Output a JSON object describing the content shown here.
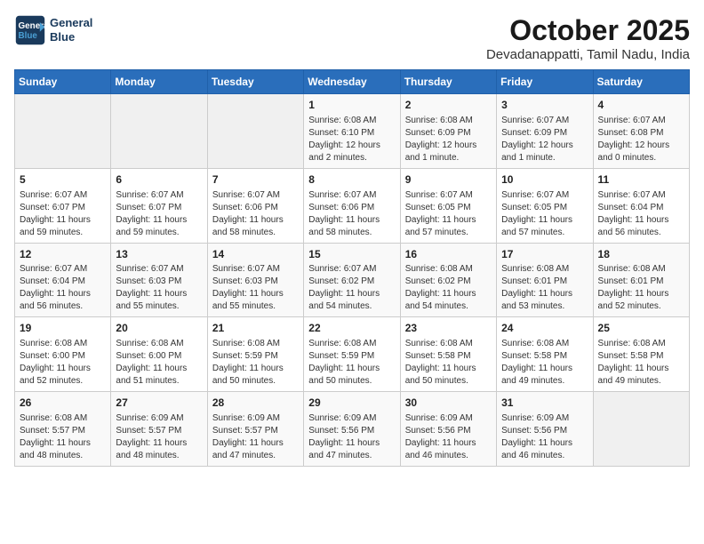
{
  "logo": {
    "line1": "General",
    "line2": "Blue"
  },
  "title": "October 2025",
  "location": "Devadanappatti, Tamil Nadu, India",
  "days_header": [
    "Sunday",
    "Monday",
    "Tuesday",
    "Wednesday",
    "Thursday",
    "Friday",
    "Saturday"
  ],
  "weeks": [
    [
      {
        "day": "",
        "info": ""
      },
      {
        "day": "",
        "info": ""
      },
      {
        "day": "",
        "info": ""
      },
      {
        "day": "1",
        "info": "Sunrise: 6:08 AM\nSunset: 6:10 PM\nDaylight: 12 hours\nand 2 minutes."
      },
      {
        "day": "2",
        "info": "Sunrise: 6:08 AM\nSunset: 6:09 PM\nDaylight: 12 hours\nand 1 minute."
      },
      {
        "day": "3",
        "info": "Sunrise: 6:07 AM\nSunset: 6:09 PM\nDaylight: 12 hours\nand 1 minute."
      },
      {
        "day": "4",
        "info": "Sunrise: 6:07 AM\nSunset: 6:08 PM\nDaylight: 12 hours\nand 0 minutes."
      }
    ],
    [
      {
        "day": "5",
        "info": "Sunrise: 6:07 AM\nSunset: 6:07 PM\nDaylight: 11 hours\nand 59 minutes."
      },
      {
        "day": "6",
        "info": "Sunrise: 6:07 AM\nSunset: 6:07 PM\nDaylight: 11 hours\nand 59 minutes."
      },
      {
        "day": "7",
        "info": "Sunrise: 6:07 AM\nSunset: 6:06 PM\nDaylight: 11 hours\nand 58 minutes."
      },
      {
        "day": "8",
        "info": "Sunrise: 6:07 AM\nSunset: 6:06 PM\nDaylight: 11 hours\nand 58 minutes."
      },
      {
        "day": "9",
        "info": "Sunrise: 6:07 AM\nSunset: 6:05 PM\nDaylight: 11 hours\nand 57 minutes."
      },
      {
        "day": "10",
        "info": "Sunrise: 6:07 AM\nSunset: 6:05 PM\nDaylight: 11 hours\nand 57 minutes."
      },
      {
        "day": "11",
        "info": "Sunrise: 6:07 AM\nSunset: 6:04 PM\nDaylight: 11 hours\nand 56 minutes."
      }
    ],
    [
      {
        "day": "12",
        "info": "Sunrise: 6:07 AM\nSunset: 6:04 PM\nDaylight: 11 hours\nand 56 minutes."
      },
      {
        "day": "13",
        "info": "Sunrise: 6:07 AM\nSunset: 6:03 PM\nDaylight: 11 hours\nand 55 minutes."
      },
      {
        "day": "14",
        "info": "Sunrise: 6:07 AM\nSunset: 6:03 PM\nDaylight: 11 hours\nand 55 minutes."
      },
      {
        "day": "15",
        "info": "Sunrise: 6:07 AM\nSunset: 6:02 PM\nDaylight: 11 hours\nand 54 minutes."
      },
      {
        "day": "16",
        "info": "Sunrise: 6:08 AM\nSunset: 6:02 PM\nDaylight: 11 hours\nand 54 minutes."
      },
      {
        "day": "17",
        "info": "Sunrise: 6:08 AM\nSunset: 6:01 PM\nDaylight: 11 hours\nand 53 minutes."
      },
      {
        "day": "18",
        "info": "Sunrise: 6:08 AM\nSunset: 6:01 PM\nDaylight: 11 hours\nand 52 minutes."
      }
    ],
    [
      {
        "day": "19",
        "info": "Sunrise: 6:08 AM\nSunset: 6:00 PM\nDaylight: 11 hours\nand 52 minutes."
      },
      {
        "day": "20",
        "info": "Sunrise: 6:08 AM\nSunset: 6:00 PM\nDaylight: 11 hours\nand 51 minutes."
      },
      {
        "day": "21",
        "info": "Sunrise: 6:08 AM\nSunset: 5:59 PM\nDaylight: 11 hours\nand 50 minutes."
      },
      {
        "day": "22",
        "info": "Sunrise: 6:08 AM\nSunset: 5:59 PM\nDaylight: 11 hours\nand 50 minutes."
      },
      {
        "day": "23",
        "info": "Sunrise: 6:08 AM\nSunset: 5:58 PM\nDaylight: 11 hours\nand 50 minutes."
      },
      {
        "day": "24",
        "info": "Sunrise: 6:08 AM\nSunset: 5:58 PM\nDaylight: 11 hours\nand 49 minutes."
      },
      {
        "day": "25",
        "info": "Sunrise: 6:08 AM\nSunset: 5:58 PM\nDaylight: 11 hours\nand 49 minutes."
      }
    ],
    [
      {
        "day": "26",
        "info": "Sunrise: 6:08 AM\nSunset: 5:57 PM\nDaylight: 11 hours\nand 48 minutes."
      },
      {
        "day": "27",
        "info": "Sunrise: 6:09 AM\nSunset: 5:57 PM\nDaylight: 11 hours\nand 48 minutes."
      },
      {
        "day": "28",
        "info": "Sunrise: 6:09 AM\nSunset: 5:57 PM\nDaylight: 11 hours\nand 47 minutes."
      },
      {
        "day": "29",
        "info": "Sunrise: 6:09 AM\nSunset: 5:56 PM\nDaylight: 11 hours\nand 47 minutes."
      },
      {
        "day": "30",
        "info": "Sunrise: 6:09 AM\nSunset: 5:56 PM\nDaylight: 11 hours\nand 46 minutes."
      },
      {
        "day": "31",
        "info": "Sunrise: 6:09 AM\nSunset: 5:56 PM\nDaylight: 11 hours\nand 46 minutes."
      },
      {
        "day": "",
        "info": ""
      }
    ]
  ]
}
